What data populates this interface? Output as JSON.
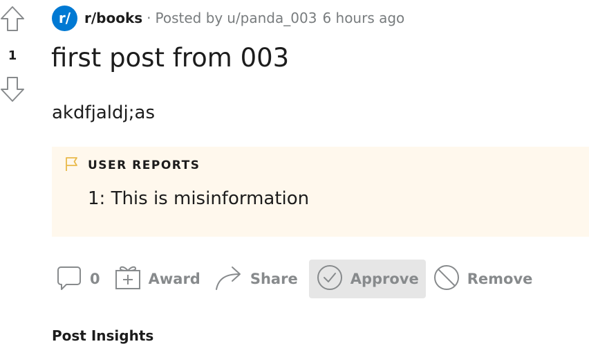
{
  "vote": {
    "score": "1"
  },
  "post": {
    "subreddit_icon": "r/",
    "subreddit": "r/books",
    "separator": "·",
    "posted_by_label": "Posted by",
    "author": "u/panda_003",
    "time": "6 hours ago",
    "title": "first post from 003",
    "body": "akdfjaldj;as"
  },
  "reports": {
    "heading": "USER REPORTS",
    "items": [
      "1: This is misinformation"
    ]
  },
  "actions": {
    "comments_count": "0",
    "award_label": "Award",
    "share_label": "Share",
    "approve_label": "Approve",
    "remove_label": "Remove"
  },
  "insights": {
    "heading": "Post Insights"
  },
  "icons": {
    "upvote": "arrow-up-outline-icon",
    "downvote": "arrow-down-outline-icon",
    "flag": "flag-icon",
    "comment": "comment-bubble-icon",
    "award": "gift-icon",
    "share": "share-arrow-icon",
    "approve": "check-circle-icon",
    "remove": "ban-icon"
  },
  "colors": {
    "accent": "#0079d3",
    "reports_bg": "#fff8ed",
    "flag": "#e9b949",
    "muted": "#878a8c"
  }
}
